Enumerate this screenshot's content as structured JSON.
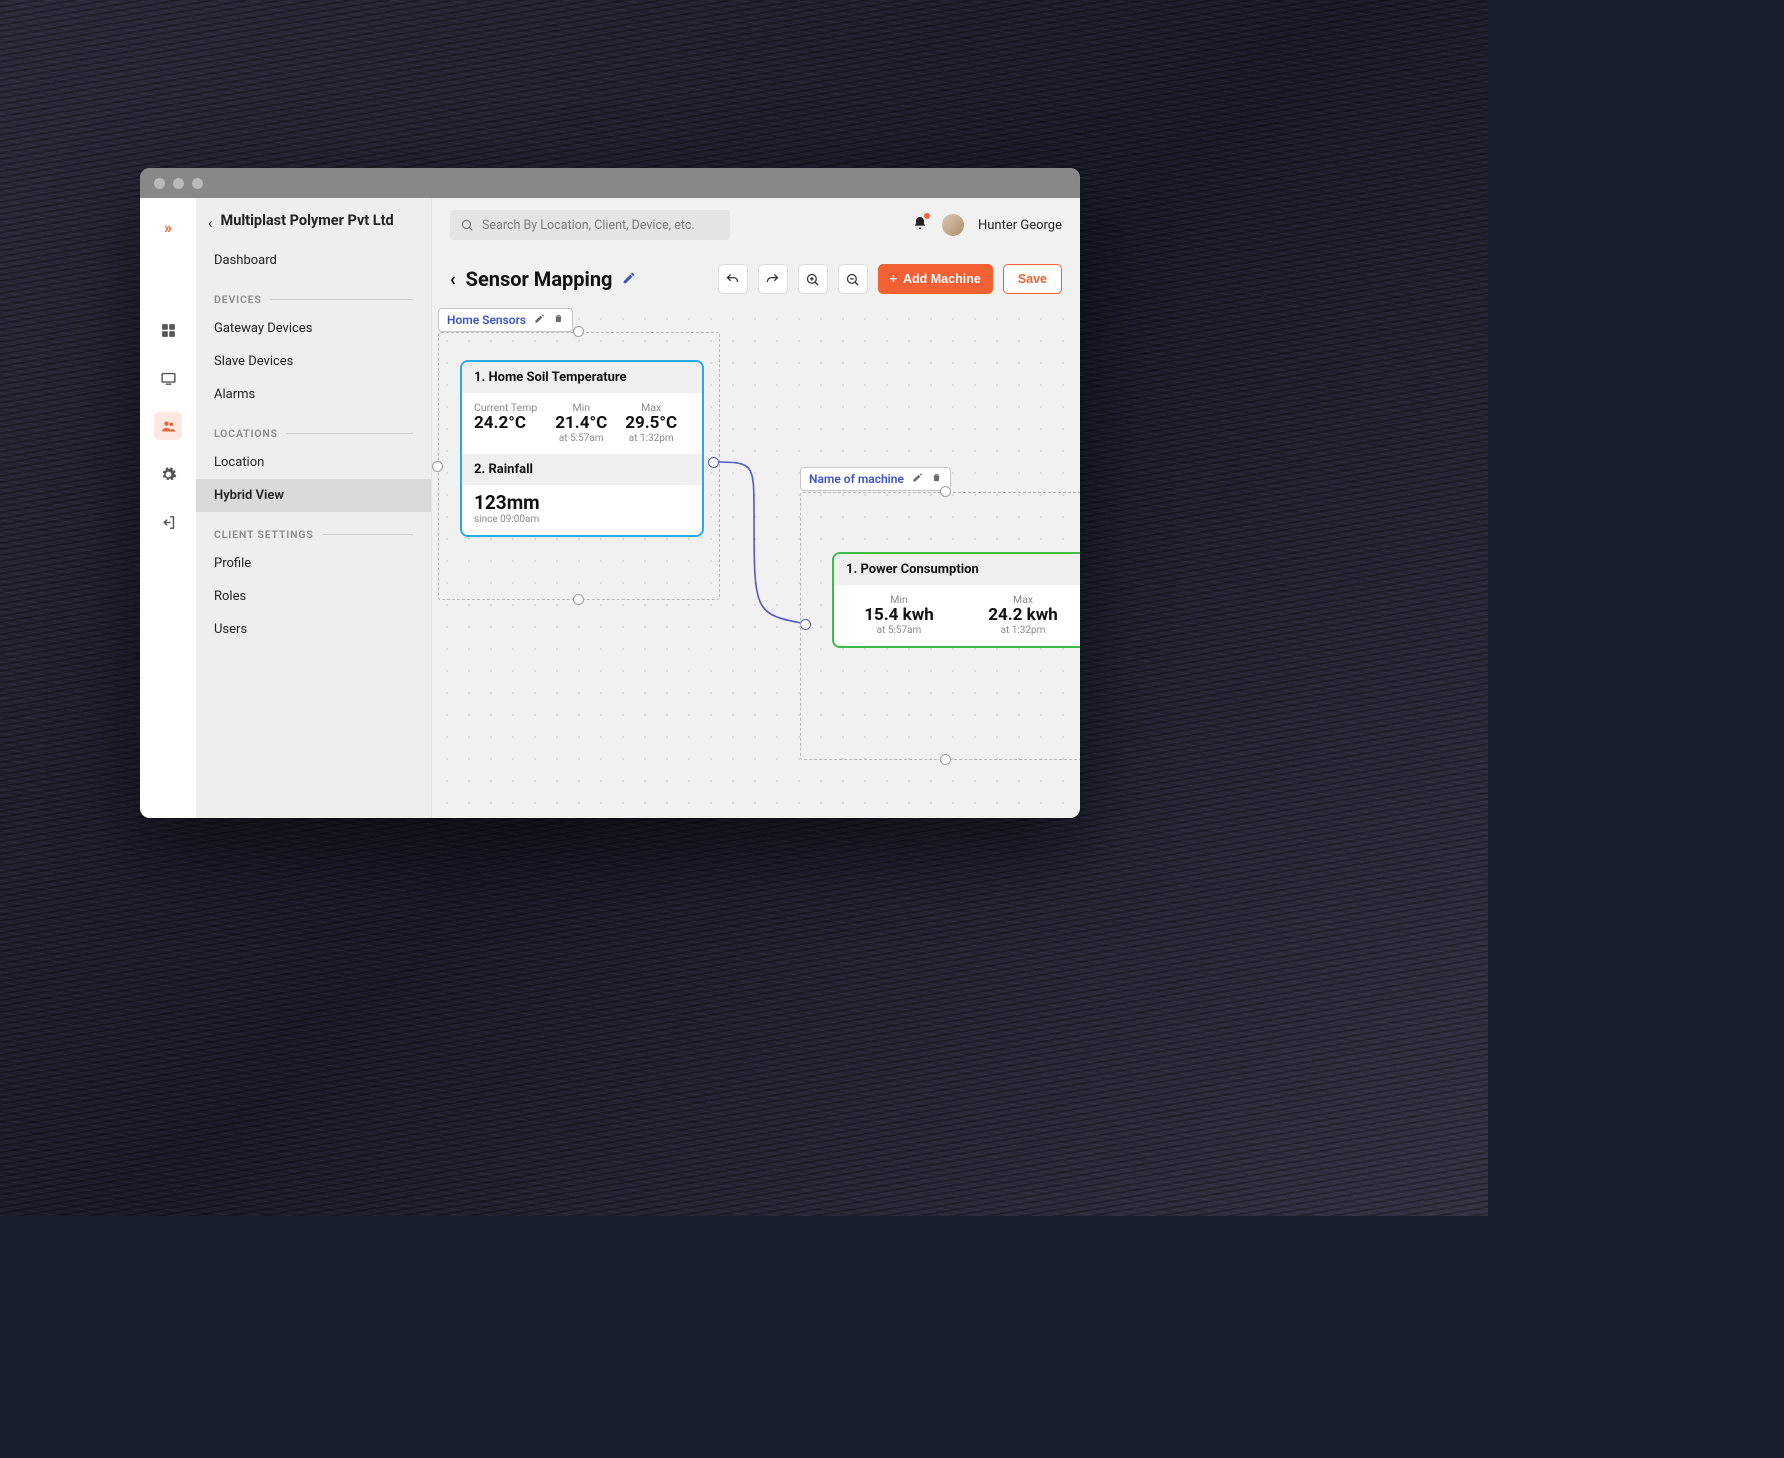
{
  "header": {
    "company_name": "Multiplast Polymer Pvt Ltd",
    "search_placeholder": "Search By Location, Client, Device, etc.",
    "username": "Hunter George"
  },
  "sidebar": {
    "items": {
      "dashboard": "Dashboard",
      "gateway": "Gateway Devices",
      "slave": "Slave Devices",
      "alarms": "Alarms",
      "location": "Location",
      "hybrid": "Hybrid View",
      "profile": "Profile",
      "roles": "Roles",
      "users": "Users"
    },
    "sections": {
      "devices": "DEVICES",
      "locations": "LOCATIONS",
      "client_settings": "CLIENT SETTINGS"
    }
  },
  "page": {
    "title": "Sensor Mapping",
    "add_machine_label": "Add Machine",
    "save_label": "Save"
  },
  "canvas": {
    "group1": {
      "label": "Home Sensors",
      "card1": {
        "title": "1. Home Soil Temperature",
        "current_label": "Current Temp",
        "current_value": "24.2°C",
        "min_label": "Min",
        "min_value": "21.4°C",
        "min_sub": "at 5:57am",
        "max_label": "Max",
        "max_value": "29.5°C",
        "max_sub": "at 1:32pm"
      },
      "card2": {
        "title": "2. Rainfall",
        "value": "123mm",
        "sub": "since 09:00am"
      }
    },
    "group2": {
      "label": "Name of machine",
      "card1": {
        "title": "1. Power Consumption",
        "min_label": "Min",
        "min_value": "15.4 kwh",
        "min_sub": "at 5:57am",
        "max_label": "Max",
        "max_value": "24.2 kwh",
        "max_sub": "at 1:32pm"
      }
    }
  }
}
